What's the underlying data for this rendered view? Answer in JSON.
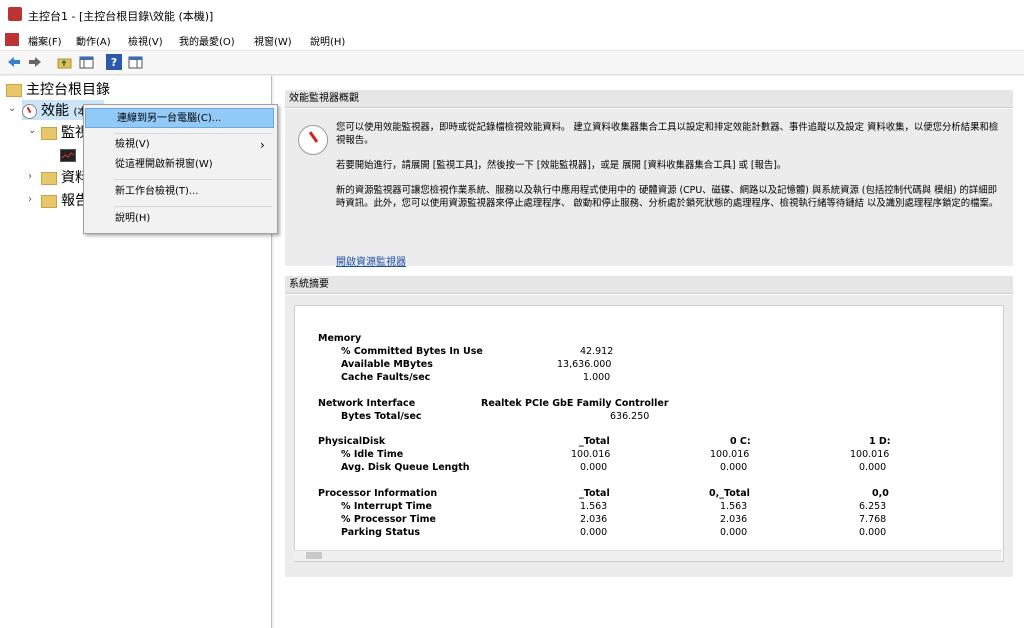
{
  "window": {
    "title": "主控台1 - [主控台根目錄\\效能 (本機)]"
  },
  "menu": [
    "檔案(F)",
    "動作(A)",
    "檢視(V)",
    "我的最愛(O)",
    "視窗(W)",
    "說明(H)"
  ],
  "toolbar": {
    "icons": [
      "back-arrow-icon",
      "forward-arrow-icon",
      "up-folder-icon",
      "show-hide-tree-icon",
      "help-icon",
      "show-action-pane-icon"
    ],
    "help_glyph": "?"
  },
  "tree": {
    "root": "主控台根目錄",
    "perf": "效能",
    "perf_suffix": "(本機)",
    "monitor": "監視工具",
    "datacollector": "資料收集器集合",
    "reports": "報告"
  },
  "context_menu": {
    "connect": "連線到另一台電腦(C)...",
    "view": "檢視(V)",
    "new_window": "從這裡開啟新視窗(W)",
    "new_taskpad": "新工作台檢視(T)...",
    "help": "說明(H)",
    "submenu_arrow": "›"
  },
  "overview": {
    "header": "效能監視器概觀",
    "p1": "您可以使用效能監視器，即時或從記錄檔檢視效能資料。 建立資料收集器集合工具以設定和排定效能計數器、事件追蹤以及設定 資料收集，以便您分析結果和檢視報告。",
    "p2": "若要開始進行，請展開 [監視工具]，然後按一下 [效能監視器]，或是 展開 [資料收集器集合工具] 或 [報告]。",
    "p3": "新的資源監視器可讓您檢視作業系統、服務以及執行中應用程式使用中的 硬體資源 (CPU、磁碟、網路以及記憶體) 與系統資源 (包括控制代碼與 模組) 的詳細即時資訊。此外，您可以使用資源監視器來停止處理程序、 啟動和停止服務、分析處於鎖死狀態的處理程序、檢視執行緒等待鏈結 以及識別處理程序鎖定的檔案。",
    "link": "開啟資源監視器"
  },
  "summary": {
    "header": "系統摘要",
    "memory": {
      "title": "Memory",
      "rows": [
        {
          "label": "% Committed Bytes In Use",
          "value": "42.912"
        },
        {
          "label": "Available MBytes",
          "value": "13,636.000"
        },
        {
          "label": "Cache Faults/sec",
          "value": "1.000"
        }
      ]
    },
    "network": {
      "title": "Network Interface",
      "adapter": "Realtek PCIe GbE Family Controller",
      "rows": [
        {
          "label": "Bytes Total/sec",
          "value": "636.250"
        }
      ]
    },
    "disk": {
      "title": "PhysicalDisk",
      "cols": [
        "_Total",
        "0 C:",
        "1 D:"
      ],
      "rows": [
        {
          "label": "% Idle Time",
          "values": [
            "100.016",
            "100.016",
            "100.016"
          ]
        },
        {
          "label": "Avg. Disk Queue Length",
          "values": [
            "0.000",
            "0.000",
            "0.000"
          ]
        }
      ]
    },
    "processor": {
      "title": "Processor Information",
      "cols": [
        "_Total",
        "0,_Total",
        "0,0"
      ],
      "rows": [
        {
          "label": "% Interrupt Time",
          "values": [
            "1.563",
            "1.563",
            "6.253"
          ]
        },
        {
          "label": "% Processor Time",
          "values": [
            "2.036",
            "2.036",
            "7.768"
          ]
        },
        {
          "label": "Parking Status",
          "values": [
            "0.000",
            "0.000",
            "0.000"
          ]
        }
      ]
    }
  }
}
